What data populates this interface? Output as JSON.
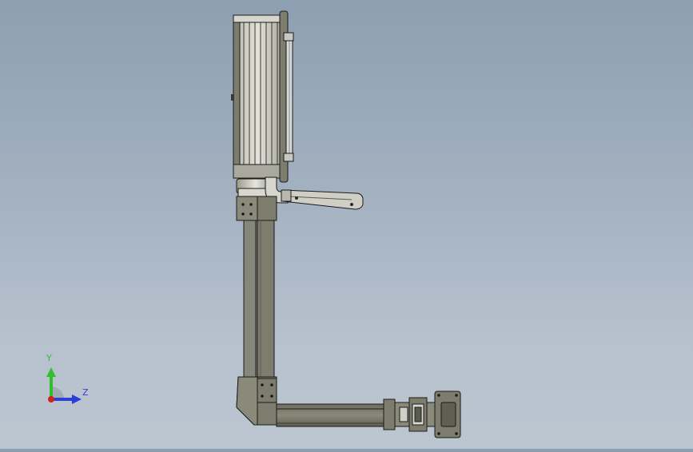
{
  "viewport": {
    "name": "cad-3d-viewport",
    "background_top": "#8e9fb2",
    "background_bottom": "#bcc6d1",
    "model_body_color": "#7d7d6e",
    "model_light_color": "#c8c8c0",
    "model_edge_color": "#1a1a1a"
  },
  "triad": {
    "y_label": "Y",
    "z_label": "Z",
    "y_color": "#2fbf2f",
    "z_color": "#2a3fd6",
    "x_color": "#d02020"
  }
}
